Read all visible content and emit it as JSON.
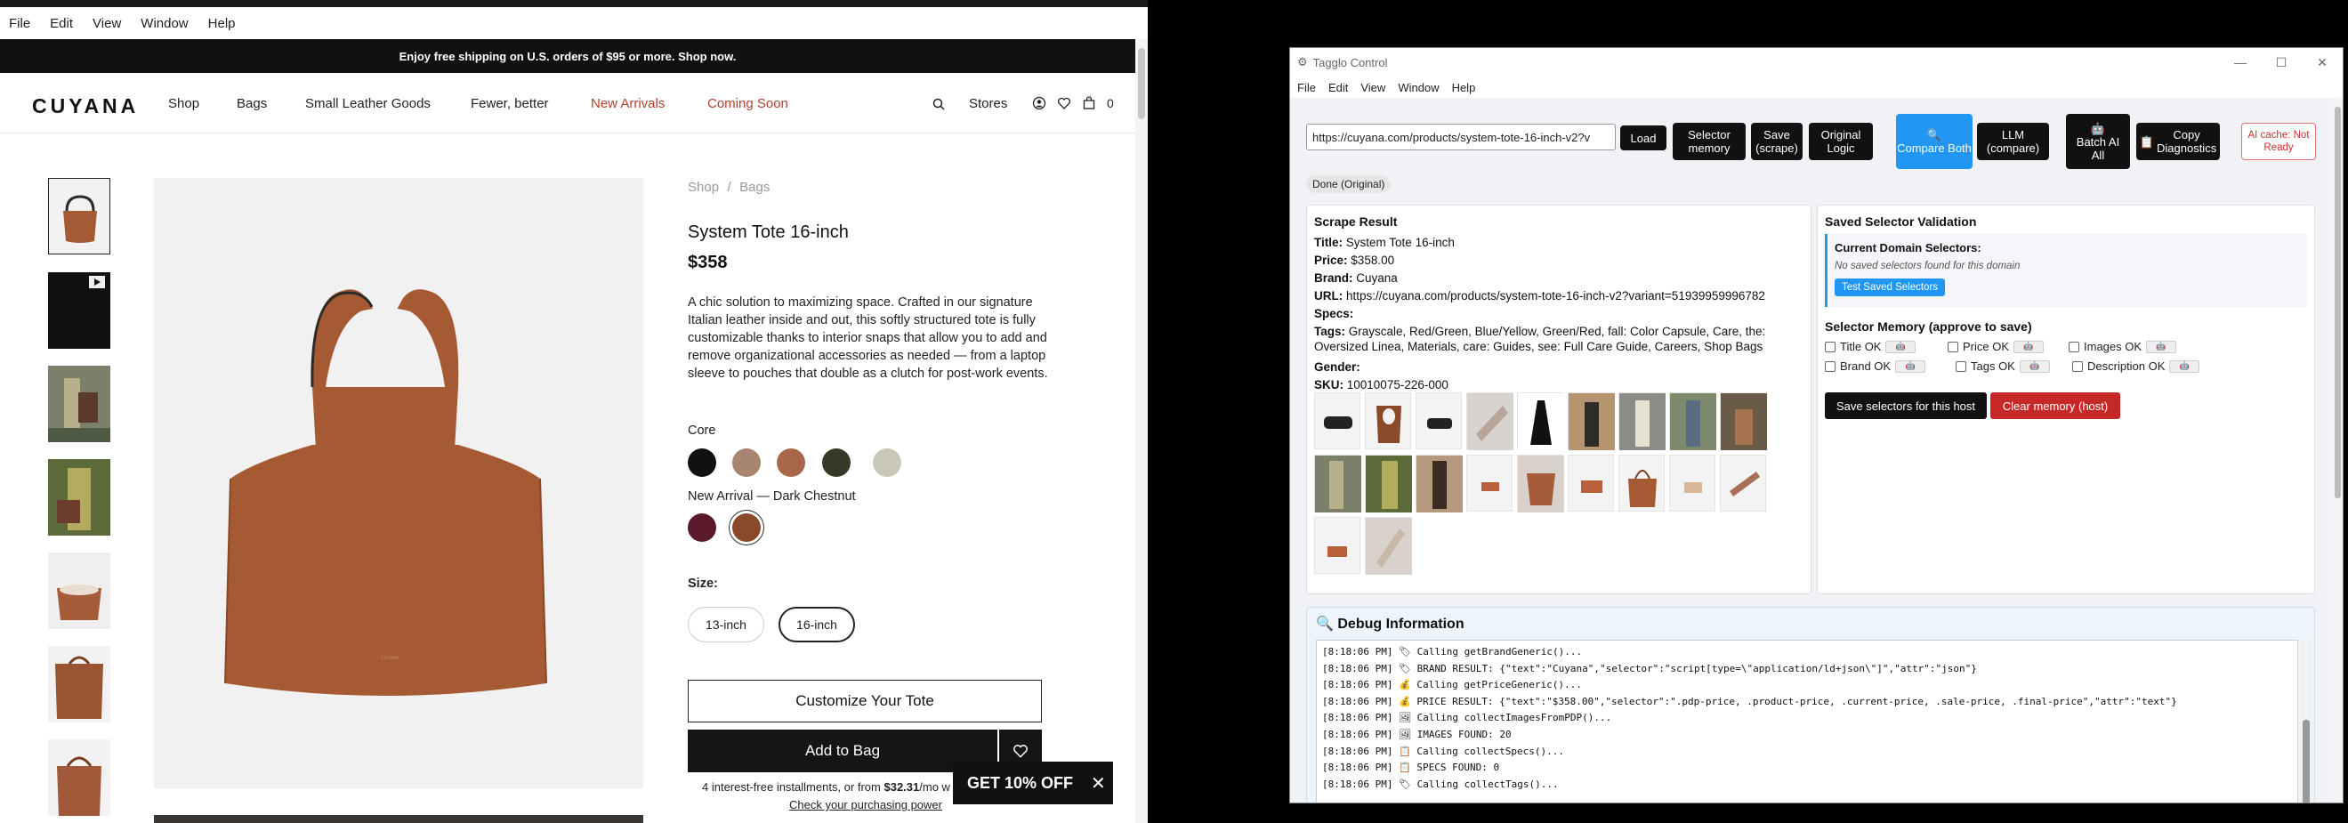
{
  "left_window": {
    "menubar": [
      "File",
      "Edit",
      "View",
      "Window",
      "Help"
    ],
    "promo": "Enjoy free shipping on U.S. orders of $95 or more. Shop now.",
    "logo": "CUYANA",
    "nav": {
      "shop": "Shop",
      "bags": "Bags",
      "slg": "Small Leather Goods",
      "fewer": "Fewer, better",
      "new_arrivals": "New Arrivals",
      "coming_soon": "Coming Soon",
      "stores": "Stores",
      "cart_count": "0",
      "accent_red": "#b3412b"
    },
    "breadcrumb": {
      "shop": "Shop",
      "sep": "/",
      "bags": "Bags"
    },
    "product": {
      "title": "System Tote 16-inch",
      "price": "$358",
      "description": "A chic solution to maximizing space. Crafted in our signature Italian leather inside and out, this softly structured tote is fully customizable thanks to interior snaps that allow you to add and remove organizational accessories as needed — from a laptop sleeve to pouches that double as a clutch for post-work events.",
      "core_label": "Core",
      "core_swatches": [
        "#111111",
        "#a88570",
        "#a8674a",
        "#343a27",
        "#c8c7b8"
      ],
      "new_arrival_label": "New Arrival — Dark Chestnut",
      "new_arrival_swatches": [
        "#5b1a2c",
        "#8a4a2a"
      ],
      "size_label": "Size:",
      "sizes": [
        "13-inch",
        "16-inch"
      ],
      "selected_size": "16-inch",
      "customize": "Customize Your Tote",
      "add_to_bag": "Add to Bag",
      "installments_prefix": "4 interest-free installments, or from",
      "installments_amount": "$32.31",
      "installments_suffix": "/mo w",
      "purchasing_power": "Check your purchasing power",
      "popup": "GET 10% OFF"
    }
  },
  "right_window": {
    "title": "Tagglo Control",
    "menubar": [
      "File",
      "Edit",
      "View",
      "Window",
      "Help"
    ],
    "url_value": "https://cuyana.com/products/system-tote-16-inch-v2?v",
    "buttons": {
      "load": "Load",
      "selector_memory": "Selector memory",
      "save_scrape": "Save (scrape)",
      "original_logic": "Original Logic",
      "compare_both": "Compare Both",
      "llm_compare": "LLM (compare)",
      "batch_ai": "Batch AI All",
      "copy_diag": "Copy Diagnostics"
    },
    "ai_cache": "AI cache: Not Ready",
    "status": "Done (Original)",
    "scrape": {
      "heading": "Scrape Result",
      "title_label": "Title:",
      "title": "System Tote 16-inch",
      "price_label": "Price:",
      "price": "$358.00",
      "brand_label": "Brand:",
      "brand": "Cuyana",
      "url_label": "URL:",
      "url": "https://cuyana.com/products/system-tote-16-inch-v2?variant=51939959996782",
      "specs_label": "Specs:",
      "tags_label": "Tags:",
      "tags": "Grayscale, Red/Green, Blue/Yellow, Green/Red, fall: Color Capsule, Care, the: Oversized Linea, Materials, care: Guides, see: Full Care Guide, Careers, Shop Bags",
      "gender_label": "Gender:",
      "sku_label": "SKU:",
      "sku": "10010075-226-000"
    },
    "validation": {
      "heading": "Saved Selector Validation",
      "current_domain": "Current Domain Selectors:",
      "no_saved": "No saved selectors found for this domain",
      "test_saved": "Test Saved Selectors",
      "memory_heading": "Selector Memory (approve to save)",
      "checks": [
        "Title OK",
        "Price OK",
        "Images OK",
        "Brand OK",
        "Tags OK",
        "Description OK"
      ],
      "save_host": "Save selectors for this host",
      "clear_host": "Clear memory (host)"
    },
    "debug": {
      "heading": "Debug Information",
      "lines": [
        "[8:18:06 PM] 🏷 Calling getBrandGeneric()...",
        "[8:18:06 PM] 🏷 BRAND RESULT: {\"text\":\"Cuyana\",\"selector\":\"script[type=\\\"application/ld+json\\\"]\",\"attr\":\"json\"}",
        "[8:18:06 PM] 💰 Calling getPriceGeneric()...",
        "[8:18:06 PM] 💰 PRICE RESULT: {\"text\":\"$358.00\",\"selector\":\".pdp-price, .product-price, .current-price, .sale-price, .final-price\",\"attr\":\"text\"}",
        "[8:18:06 PM] 🖼 Calling collectImagesFromPDP()...",
        "[8:18:06 PM] 🖼 IMAGES FOUND: 20",
        "[8:18:06 PM] 📋 Calling collectSpecs()...",
        "[8:18:06 PM] 📋 SPECS FOUND: 0",
        "[8:18:06 PM] 🏷 Calling collectTags()..."
      ]
    }
  }
}
